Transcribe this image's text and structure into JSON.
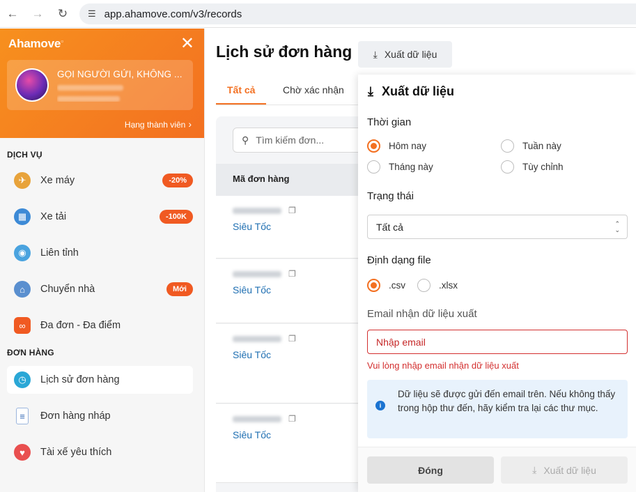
{
  "browser": {
    "url": "app.ahamove.com/v3/records"
  },
  "sidebar": {
    "logo": "Ahamove",
    "user_name": "GỌI NGƯỜI GỬI, KHÔNG ...",
    "member_link": "Hạng thành viên",
    "services_title": "DỊCH VỤ",
    "services": [
      {
        "label": "Xe máy",
        "badge": "-20%",
        "icon": "motorbike-icon"
      },
      {
        "label": "Xe tải",
        "badge": "-100K",
        "icon": "truck-icon"
      },
      {
        "label": "Liên tỉnh",
        "badge": "",
        "icon": "intercity-icon"
      },
      {
        "label": "Chuyển nhà",
        "badge": "Mới",
        "icon": "house-move-icon"
      },
      {
        "label": "Đa đơn - Đa điểm",
        "badge": "",
        "icon": "multi-order-icon"
      }
    ],
    "orders_title": "ĐƠN HÀNG",
    "orders": [
      {
        "label": "Lịch sử đơn hàng",
        "icon": "clock-icon"
      },
      {
        "label": "Đơn hàng nháp",
        "icon": "draft-icon"
      },
      {
        "label": "Tài xế yêu thích",
        "icon": "heart-icon"
      }
    ]
  },
  "main": {
    "title": "Lịch sử đơn hàng",
    "export_button": "Xuất dữ liệu",
    "tabs": [
      "Tất cả",
      "Chờ xác nhận"
    ],
    "search_placeholder": "Tìm kiếm đơn...",
    "column_header": "Mã đơn hàng",
    "rows": [
      {
        "type": "Siêu Tốc"
      },
      {
        "type": "Siêu Tốc"
      },
      {
        "type": "Siêu Tốc"
      },
      {
        "type": "Siêu Tốc"
      }
    ]
  },
  "panel": {
    "title": "Xuất dữ liệu",
    "time_label": "Thời gian",
    "time_options": [
      "Hôm nay",
      "Tuần này",
      "Tháng này",
      "Tùy chỉnh"
    ],
    "time_selected": "Hôm nay",
    "status_label": "Trạng thái",
    "status_value": "Tất cả",
    "format_label": "Định dạng file",
    "format_options": [
      ".csv",
      ".xlsx"
    ],
    "format_selected": ".csv",
    "email_label": "Email nhận dữ liệu xuất",
    "email_placeholder": "Nhập email",
    "email_error": "Vui lòng nhập email nhận dữ liệu xuất",
    "info_text": "Dữ liệu sẽ được gửi đến email trên. Nếu không thấy trong hộp thư đến, hãy kiểm tra lại các thư mục.",
    "close_button": "Đóng",
    "export_button": "Xuất dữ liệu"
  },
  "colors": {
    "brand": "#f37021",
    "link": "#1f6fb2",
    "error": "#d32f2f"
  }
}
